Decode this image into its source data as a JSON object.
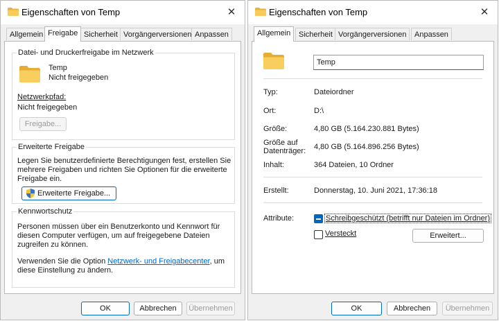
{
  "left_window": {
    "title": "Eigenschaften von Temp",
    "close_symbol": "✕",
    "tabs": [
      "Allgemein",
      "Freigabe",
      "Sicherheit",
      "Vorgängerversionen",
      "Anpassen"
    ],
    "active_tab": "Freigabe",
    "network_share": {
      "group_title": "Datei- und Druckerfreigabe im Netzwerk",
      "folder_name": "Temp",
      "share_status": "Nicht freigegeben",
      "path_label": "Netzwerkpfad:",
      "path_value": "Nicht freigegeben",
      "share_button": "Freigabe..."
    },
    "advanced_share": {
      "group_title": "Erweiterte Freigabe",
      "description_lines": [
        "Legen Sie benutzerdefinierte Berechtigungen fest, erstellen Sie",
        "mehrere Freigaben und richten Sie Optionen für die erweiterte",
        "Freigabe ein."
      ],
      "button_label": "Erweiterte Freigabe..."
    },
    "password_protection": {
      "group_title": "Kennwortschutz",
      "description_lines": [
        "Personen müssen über ein Benutzerkonto und Kennwort für",
        "diesen Computer verfügen, um auf freigegebene Dateien",
        "zugreifen zu können."
      ],
      "option_text_before": "Verwenden Sie die Option ",
      "option_link": "Netzwerk- und Freigabecenter",
      "option_text_after": ", um",
      "option_line2": "diese Einstellung zu ändern."
    },
    "buttons": {
      "ok": "OK",
      "cancel": "Abbrechen",
      "apply": "Übernehmen"
    }
  },
  "right_window": {
    "title": "Eigenschaften von Temp",
    "close_symbol": "✕",
    "tabs": [
      "Allgemein",
      "Sicherheit",
      "Vorgängerversionen",
      "Anpassen"
    ],
    "active_tab": "Allgemein",
    "name_value": "Temp",
    "properties": {
      "type_label": "Typ:",
      "type_value": "Dateiordner",
      "location_label": "Ort:",
      "location_value": "D:\\",
      "size_label": "Größe:",
      "size_value": "4,80 GB (5.164.230.881 Bytes)",
      "disk_size_label_1": "Größe auf",
      "disk_size_label_2": "Datenträger:",
      "disk_size_value": "4,80 GB (5.164.896.256 Bytes)",
      "contents_label": "Inhalt:",
      "contents_value": "364 Dateien, 10 Ordner",
      "created_label": "Erstellt:",
      "created_value": "Donnerstag, 10. Juni 2021, 17:36:18"
    },
    "attributes": {
      "label": "Attribute:",
      "readonly": "Schreibgeschützt (betrifft nur Dateien im Ordner)",
      "hidden": "Versteckt",
      "advanced_button": "Erweitert..."
    },
    "buttons": {
      "ok": "OK",
      "cancel": "Abbrechen",
      "apply": "Übernehmen"
    }
  },
  "colors": {
    "accent": "#0067c0",
    "folder": "#f5c649",
    "link": "#0066cc"
  }
}
